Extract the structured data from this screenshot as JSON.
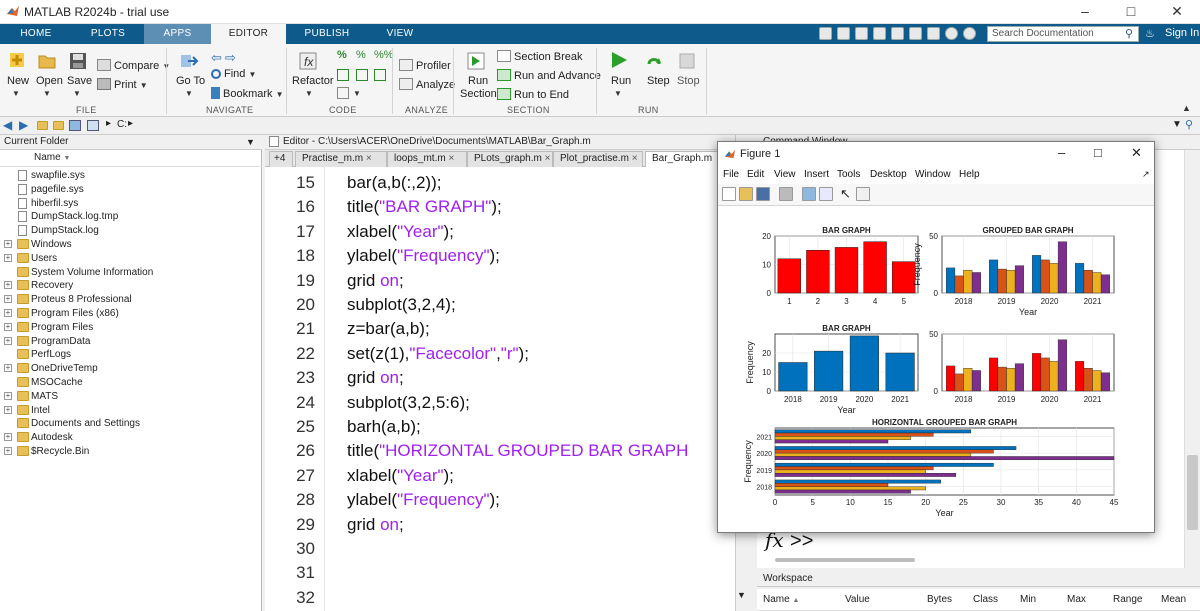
{
  "app": {
    "title": "MATLAB R2024b - trial use",
    "window_controls": [
      "–",
      "□",
      "✕"
    ]
  },
  "ribbon_tabs": [
    {
      "label": "HOME"
    },
    {
      "label": "PLOTS"
    },
    {
      "label": "APPS"
    },
    {
      "label": "EDITOR"
    },
    {
      "label": "PUBLISH"
    },
    {
      "label": "VIEW"
    }
  ],
  "search": {
    "placeholder": "Search Documentation"
  },
  "signin": "Sign In",
  "ribbon": {
    "file": {
      "new": "New",
      "open": "Open",
      "save": "Save",
      "compare": "Compare",
      "print": "Print",
      "section": "FILE"
    },
    "navigate": {
      "goto_line1": "Go To",
      "find": "Find",
      "bookmark": "Bookmark",
      "section": "NAVIGATE"
    },
    "code": {
      "refactor": "Refactor",
      "section": "CODE"
    },
    "analyze": {
      "profiler": "Profiler",
      "analyze": "Analyze",
      "section": "ANALYZE"
    },
    "section_group": {
      "run_section_l1": "Run",
      "run_section_l2": "Section",
      "section_break": "Section Break",
      "run_and_advance": "Run and Advance",
      "run_to_end": "Run to End",
      "section": "SECTION"
    },
    "run": {
      "run": "Run",
      "step": "Step",
      "stop": "Stop",
      "section": "RUN"
    }
  },
  "address": {
    "path": "C:",
    "sep": "▸"
  },
  "current_folder": {
    "title": "Current Folder",
    "name_header": "Name",
    "items": [
      {
        "name": "swapfile.sys",
        "type": "file",
        "expandable": false
      },
      {
        "name": "pagefile.sys",
        "type": "file",
        "expandable": false
      },
      {
        "name": "hiberfil.sys",
        "type": "file",
        "expandable": false
      },
      {
        "name": "DumpStack.log.tmp",
        "type": "file",
        "expandable": false
      },
      {
        "name": "DumpStack.log",
        "type": "file",
        "expandable": false
      },
      {
        "name": "Windows",
        "type": "folder",
        "expandable": true
      },
      {
        "name": "Users",
        "type": "folder",
        "expandable": true
      },
      {
        "name": "System Volume Information",
        "type": "folder",
        "expandable": false
      },
      {
        "name": "Recovery",
        "type": "folder",
        "expandable": true
      },
      {
        "name": "Proteus 8 Professional",
        "type": "folder",
        "expandable": true
      },
      {
        "name": "Program Files (x86)",
        "type": "folder",
        "expandable": true
      },
      {
        "name": "Program Files",
        "type": "folder",
        "expandable": true
      },
      {
        "name": "ProgramData",
        "type": "folder",
        "expandable": true
      },
      {
        "name": "PerfLogs",
        "type": "folder",
        "expandable": false
      },
      {
        "name": "OneDriveTemp",
        "type": "folder",
        "expandable": true
      },
      {
        "name": "MSOCache",
        "type": "folder",
        "expandable": false
      },
      {
        "name": "MATS",
        "type": "folder",
        "expandable": true
      },
      {
        "name": "Intel",
        "type": "folder",
        "expandable": true
      },
      {
        "name": "Documents and Settings",
        "type": "folder",
        "expandable": false
      },
      {
        "name": "Autodesk",
        "type": "folder",
        "expandable": true
      },
      {
        "name": "$Recycle.Bin",
        "type": "folder",
        "expandable": true
      }
    ]
  },
  "editor": {
    "title": "Editor - C:\\Users\\ACER\\OneDrive\\Documents\\MATLAB\\Bar_Graph.m",
    "tabs": [
      {
        "label": "+4"
      },
      {
        "label": "Practise_m.m"
      },
      {
        "label": "loops_mt.m"
      },
      {
        "label": "PLots_graph.m"
      },
      {
        "label": "Plot_practise.m"
      },
      {
        "label": "Bar_Graph.m"
      }
    ],
    "lines": [
      {
        "num": "15",
        "parts": [
          {
            "t": "bar(a,b(:,2));",
            "c": ""
          }
        ]
      },
      {
        "num": "16",
        "parts": [
          {
            "t": "title(",
            "c": ""
          },
          {
            "t": "\"BAR GRAPH\"",
            "c": "str"
          },
          {
            "t": ");",
            "c": ""
          }
        ]
      },
      {
        "num": "17",
        "parts": [
          {
            "t": "xlabel(",
            "c": ""
          },
          {
            "t": "\"Year\"",
            "c": "str"
          },
          {
            "t": ");",
            "c": ""
          }
        ]
      },
      {
        "num": "18",
        "parts": [
          {
            "t": "ylabel(",
            "c": ""
          },
          {
            "t": "\"Frequency\"",
            "c": "str"
          },
          {
            "t": ");",
            "c": ""
          }
        ]
      },
      {
        "num": "19",
        "parts": [
          {
            "t": "grid ",
            "c": ""
          },
          {
            "t": "on",
            "c": "kw"
          },
          {
            "t": ";",
            "c": ""
          }
        ]
      },
      {
        "num": "20",
        "parts": [
          {
            "t": "subplot(3,2,4);",
            "c": ""
          }
        ]
      },
      {
        "num": "21",
        "parts": [
          {
            "t": "z=bar(a,b);",
            "c": ""
          }
        ]
      },
      {
        "num": "22",
        "parts": [
          {
            "t": "set(z(1),",
            "c": ""
          },
          {
            "t": "\"Facecolor\"",
            "c": "str"
          },
          {
            "t": ",",
            "c": ""
          },
          {
            "t": "\"r\"",
            "c": "str"
          },
          {
            "t": ");",
            "c": ""
          }
        ]
      },
      {
        "num": "23",
        "parts": [
          {
            "t": "grid ",
            "c": ""
          },
          {
            "t": "on",
            "c": "kw"
          },
          {
            "t": ";",
            "c": ""
          }
        ]
      },
      {
        "num": "24",
        "parts": [
          {
            "t": "subplot(3,2,5:6);",
            "c": ""
          }
        ]
      },
      {
        "num": "25",
        "parts": [
          {
            "t": "barh(a,b);",
            "c": ""
          }
        ]
      },
      {
        "num": "26",
        "parts": [
          {
            "t": "title(",
            "c": ""
          },
          {
            "t": "\"HORIZONTAL GROUPED BAR GRAPH",
            "c": "str"
          }
        ]
      },
      {
        "num": "27",
        "parts": [
          {
            "t": "xlabel(",
            "c": ""
          },
          {
            "t": "\"Year\"",
            "c": "str"
          },
          {
            "t": ");",
            "c": ""
          }
        ]
      },
      {
        "num": "28",
        "parts": [
          {
            "t": "ylabel(",
            "c": ""
          },
          {
            "t": "\"Frequency\"",
            "c": "str"
          },
          {
            "t": ");",
            "c": ""
          }
        ]
      },
      {
        "num": "29",
        "parts": [
          {
            "t": "grid ",
            "c": ""
          },
          {
            "t": "on",
            "c": "kw"
          },
          {
            "t": ";",
            "c": ""
          }
        ]
      },
      {
        "num": "30",
        "parts": []
      },
      {
        "num": "31",
        "parts": []
      },
      {
        "num": "32",
        "parts": []
      }
    ]
  },
  "command_window": {
    "title": "Command Window",
    "prompt_fx": "fx",
    "prompt": ">>"
  },
  "workspace": {
    "title": "Workspace",
    "columns": [
      "Name",
      "Value",
      "Bytes",
      "Class",
      "Min",
      "Max",
      "Range",
      "Mean"
    ]
  },
  "figure": {
    "title": "Figure 1",
    "menu": [
      "File",
      "Edit",
      "View",
      "Insert",
      "Tools",
      "Desktop",
      "Window",
      "Help"
    ],
    "colors": {
      "red": "#ff0000",
      "blue": "#0072bd",
      "orange": "#d95319",
      "yellow": "#edb120",
      "purple": "#7e2f8e"
    }
  },
  "chart_data": [
    {
      "type": "bar",
      "title": "BAR GRAPH",
      "categories": [
        "1",
        "2",
        "3",
        "4",
        "5"
      ],
      "values": [
        12,
        15,
        16,
        18,
        11
      ],
      "ylim": [
        0,
        20
      ],
      "yticks": [
        "0",
        "10",
        "20"
      ],
      "color": "#ff0000",
      "grid": true
    },
    {
      "type": "bar",
      "title": "GROUPED BAR GRAPH",
      "categories": [
        "2018",
        "2019",
        "2020",
        "2021"
      ],
      "series": [
        {
          "values": [
            22,
            29,
            33,
            26
          ]
        },
        {
          "values": [
            15,
            21,
            29,
            20
          ]
        },
        {
          "values": [
            20,
            20,
            26,
            18
          ]
        },
        {
          "values": [
            18,
            24,
            45,
            16
          ]
        }
      ],
      "xlabel": "Year",
      "ylabel": "Frequency",
      "ylim": [
        0,
        50
      ],
      "yticks": [
        "0",
        "50"
      ],
      "colors": [
        "#0072bd",
        "#d95319",
        "#edb120",
        "#7e2f8e"
      ],
      "grid": true
    },
    {
      "type": "bar",
      "title": "BAR GRAPH",
      "categories": [
        "2018",
        "2019",
        "2020",
        "2021"
      ],
      "values": [
        15,
        21,
        29,
        20
      ],
      "xlabel": "Year",
      "ylabel": "Frequency",
      "ylim": [
        0,
        30
      ],
      "yticks": [
        "0",
        "10",
        "20"
      ],
      "color": "#0072bd",
      "grid": true
    },
    {
      "type": "bar",
      "title": "",
      "categories": [
        "2018",
        "2019",
        "2020",
        "2021"
      ],
      "series": [
        {
          "values": [
            22,
            29,
            33,
            26
          ]
        },
        {
          "values": [
            15,
            21,
            29,
            20
          ]
        },
        {
          "values": [
            20,
            20,
            26,
            18
          ]
        },
        {
          "values": [
            18,
            24,
            45,
            16
          ]
        }
      ],
      "ylim": [
        0,
        50
      ],
      "yticks": [
        "0",
        "50"
      ],
      "colors": [
        "#ff0000",
        "#d95319",
        "#edb120",
        "#7e2f8e"
      ],
      "grid": true
    },
    {
      "type": "bar",
      "orientation": "horizontal",
      "title": "HORIZONTAL GROUPED BAR GRAPH",
      "categories": [
        "2018",
        "2019",
        "2020",
        "2021"
      ],
      "series": [
        {
          "values": [
            22,
            29,
            32,
            26
          ]
        },
        {
          "values": [
            15,
            21,
            29,
            21
          ]
        },
        {
          "values": [
            20,
            20,
            26,
            18
          ]
        },
        {
          "values": [
            18,
            24,
            45,
            15
          ]
        }
      ],
      "xlabel": "Year",
      "ylabel": "Frequency",
      "xlim": [
        0,
        45
      ],
      "xticks": [
        "0",
        "5",
        "10",
        "15",
        "20",
        "25",
        "30",
        "35",
        "40",
        "45"
      ],
      "colors": [
        "#0072bd",
        "#d95319",
        "#edb120",
        "#7e2f8e"
      ],
      "grid": true
    }
  ]
}
